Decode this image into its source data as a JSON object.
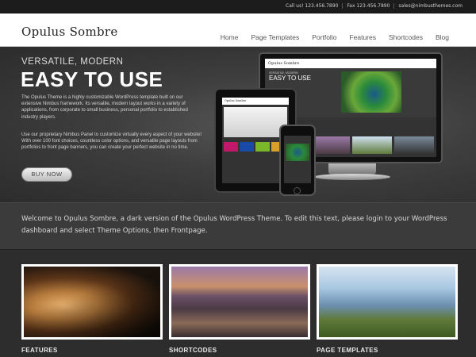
{
  "topbar": {
    "call": "Call us! 123.456.7890",
    "fax": "Fax 123.456.7890",
    "email": "sales@nimbusthemes.com"
  },
  "header": {
    "logo": "Opulus Sombre",
    "nav": [
      "Home",
      "Page Templates",
      "Portfolio",
      "Features",
      "Shortcodes",
      "Blog"
    ]
  },
  "hero": {
    "kicker": "VERSATILE, MODERN",
    "title": "EASY TO USE",
    "para1": "The Opulus Theme is a highly customizable WordPress template built on our extensive Nimbus framework. Its versatile, modern layout works in a variety of applications, from corporate to small business, personal portfolio to established industry players.",
    "para2": "Use our proprietary Nimbus Panel to customize virtually every aspect of your website! With over 100 font choices, countless color options, and versatile page layouts from portfolios to front page banners, you can create your perfect website in no time.",
    "button": "BUY NOW",
    "mockup_logo": "Opulus Sombre",
    "mockup_kicker": "VERSATILE, MODERN",
    "mockup_title": "EASY TO USE"
  },
  "welcome": {
    "text": "Welcome to Opulus Sombre, a dark version of the Opulus WordPress Theme. To edit this text, please login to your WordPress dashboard and select Theme Options, then Frontpage."
  },
  "features": {
    "items": [
      {
        "label": "FEATURES"
      },
      {
        "label": "SHORTCODES"
      },
      {
        "label": "PAGE TEMPLATES"
      }
    ]
  },
  "colors": {
    "background": "#2b2b2b",
    "header": "#ffffff",
    "accent_text": "#ffffff"
  }
}
